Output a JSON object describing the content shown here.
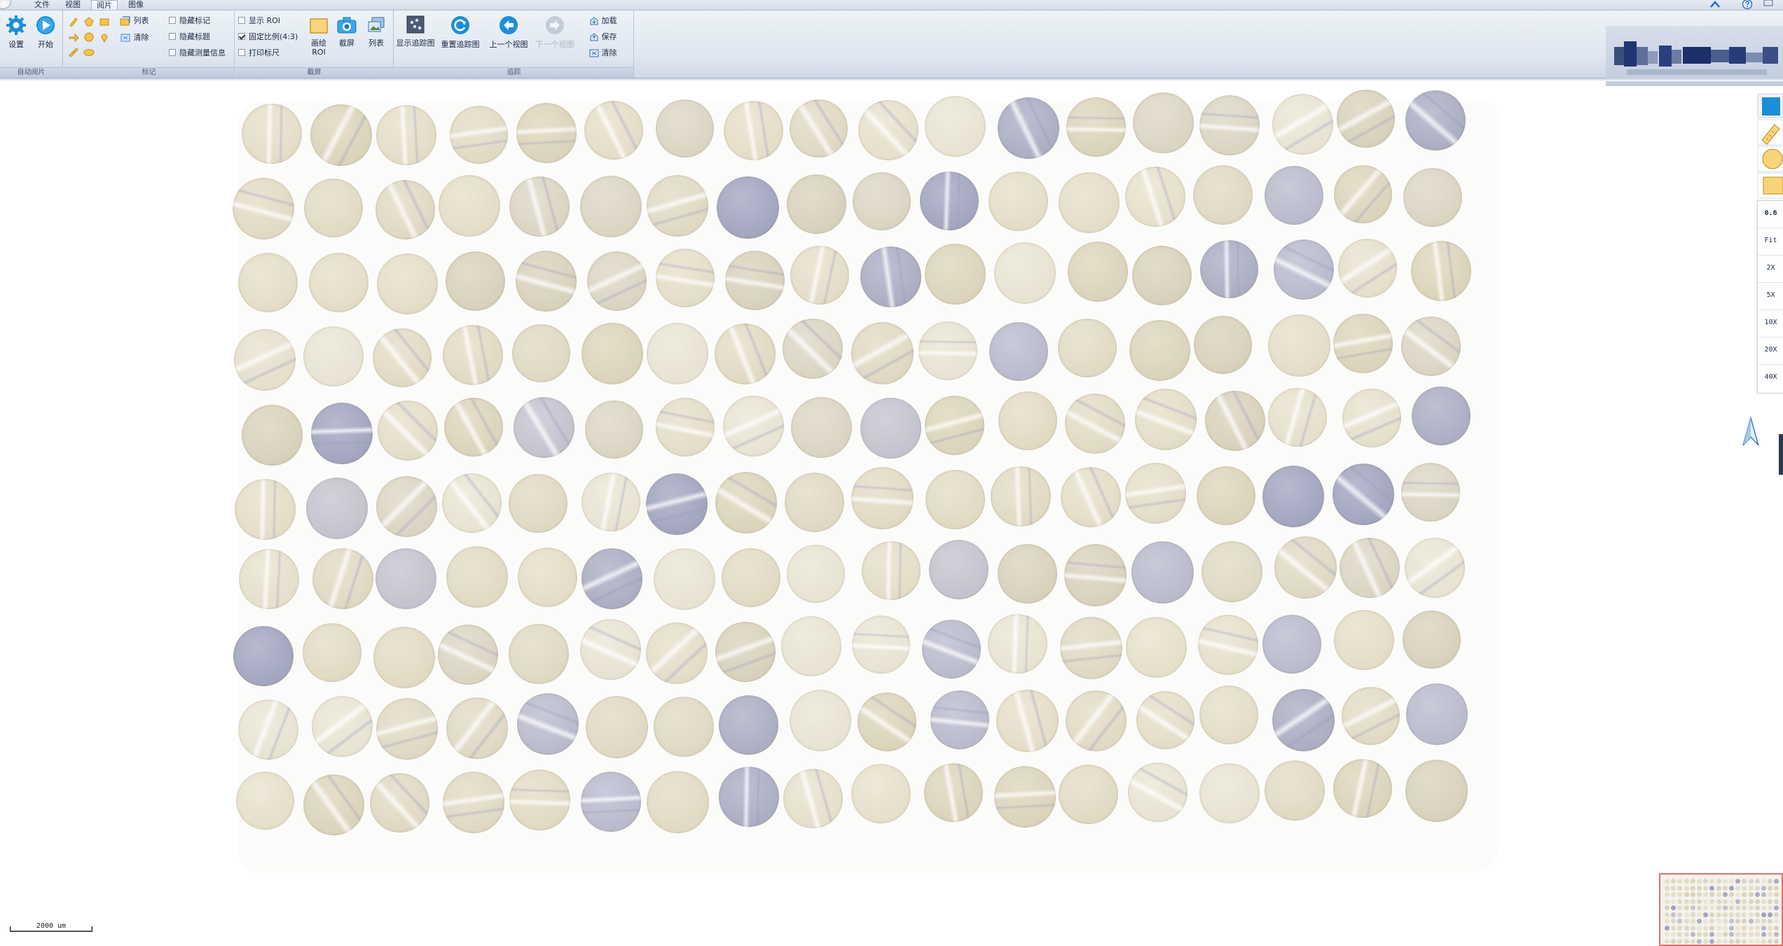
{
  "menu": {
    "tabs": [
      {
        "label": "文件",
        "active": false
      },
      {
        "label": "视图",
        "active": false
      },
      {
        "label": "阅片",
        "active": true
      },
      {
        "label": "图像",
        "active": false
      }
    ]
  },
  "ribbon": {
    "group_auto": {
      "caption": "自动阅片",
      "settings_label": "设置",
      "start_label": "开始"
    },
    "group_mark": {
      "caption": "标记",
      "list_label": "列表",
      "clear_label": "清除",
      "hide_mark_label": "隐藏标记",
      "hide_title_label": "隐藏标题",
      "hide_measure_label": "隐藏测量信息"
    },
    "group_capture": {
      "caption": "截屏",
      "show_roi_label": "显示 ROI",
      "show_roi_checked": false,
      "fixed_ratio_label": "固定比例(4:3)",
      "fixed_ratio_checked": true,
      "print_ruler_label": "打印标尺",
      "print_ruler_checked": false,
      "draw_roi_label_line1": "画绘",
      "draw_roi_label_line2": "ROI",
      "screenshot_label": "截屏",
      "list_label": "列表"
    },
    "group_track": {
      "caption": "追踪",
      "show_track_label": "显示追踪图",
      "reset_track_label": "重置追踪图",
      "prev_view_label": "上一个视图",
      "next_view_label": "下一个视图",
      "load_label": "加载",
      "save_label": "保存",
      "clear_label": "清除"
    }
  },
  "colors": {
    "ribbon_bg": "#dfe6f0",
    "accent_blue": "#1a8fd8",
    "highlight_yellow": "#f9d57a",
    "overview_border": "#e07070"
  },
  "icons": {
    "window_controls": [
      "pin-icon",
      "help-icon"
    ],
    "right_tools": [
      "select-tool-icon",
      "ruler-tool-icon",
      "circle-tool-icon",
      "rectangle-tool-icon"
    ],
    "navigation": "north-arrow-icon"
  },
  "zoom": {
    "current": "0.6",
    "presets": [
      "Fit",
      "2X",
      "5X",
      "10X",
      "20X",
      "40X"
    ]
  },
  "scale_bar": {
    "label": "2000 um"
  },
  "tissue_array": {
    "rows": 10,
    "columns": 18
  }
}
